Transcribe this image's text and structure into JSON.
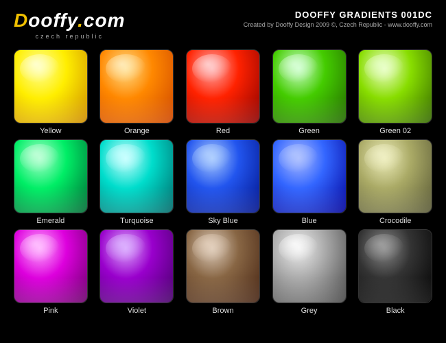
{
  "header": {
    "logo": "Dooffy.com",
    "logo_sub": "czech republic",
    "title": "DOOFFY GRADIENTS 001DC",
    "subtitle": "Created by Dooffy Design 2009 ©, Czech Republic - www.dooffy.com"
  },
  "swatches": [
    {
      "id": "yellow",
      "label": "Yellow",
      "class": "swatch-yellow"
    },
    {
      "id": "orange",
      "label": "Orange",
      "class": "swatch-orange"
    },
    {
      "id": "red",
      "label": "Red",
      "class": "swatch-red"
    },
    {
      "id": "green",
      "label": "Green",
      "class": "swatch-green"
    },
    {
      "id": "green02",
      "label": "Green 02",
      "class": "swatch-green02"
    },
    {
      "id": "emerald",
      "label": "Emerald",
      "class": "swatch-emerald"
    },
    {
      "id": "turquoise",
      "label": "Turquoise",
      "class": "swatch-turquoise"
    },
    {
      "id": "skyblue",
      "label": "Sky Blue",
      "class": "swatch-skyblue"
    },
    {
      "id": "blue",
      "label": "Blue",
      "class": "swatch-blue"
    },
    {
      "id": "crocodile",
      "label": "Crocodile",
      "class": "swatch-crocodile"
    },
    {
      "id": "pink",
      "label": "Pink",
      "class": "swatch-pink"
    },
    {
      "id": "violet",
      "label": "Violet",
      "class": "swatch-violet"
    },
    {
      "id": "brown",
      "label": "Brown",
      "class": "swatch-brown"
    },
    {
      "id": "grey",
      "label": "Grey",
      "class": "swatch-grey"
    },
    {
      "id": "black",
      "label": "Black",
      "class": "swatch-black"
    }
  ]
}
